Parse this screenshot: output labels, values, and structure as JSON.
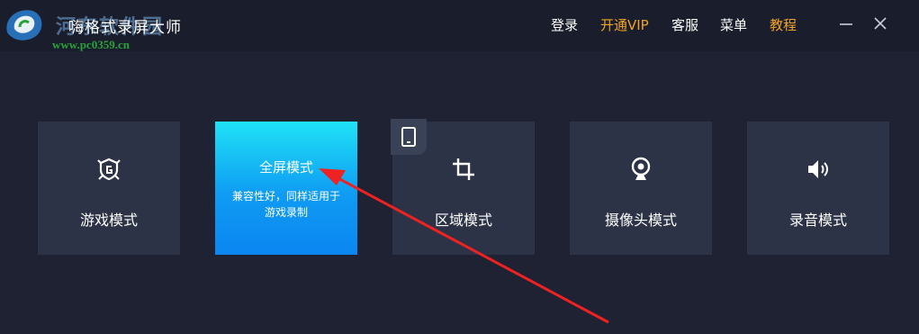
{
  "app": {
    "title": "嗨格式录屏大师",
    "watermark_text": "河东软件园",
    "watermark_url": "www.pc0359.cn"
  },
  "nav": {
    "login": "登录",
    "vip": "开通VIP",
    "service": "客服",
    "menu": "菜单",
    "tutorial": "教程"
  },
  "window_controls": [
    "minimize-icon",
    "close-icon"
  ],
  "modes": {
    "game": {
      "label": "游戏模式",
      "icon": "game-shield-icon"
    },
    "fullscreen": {
      "label": "全屏模式",
      "description": "兼容性好，同样适用于游戏录制",
      "selected": true
    },
    "region": {
      "label": "区域模式",
      "icon": "crop-icon",
      "badge_icon": "tablet-icon"
    },
    "camera": {
      "label": "摄像头模式",
      "icon": "webcam-icon"
    },
    "audio": {
      "label": "录音模式",
      "icon": "speaker-icon"
    }
  },
  "colors": {
    "background": "#1e2232",
    "titlebar": "#1a1e2c",
    "card": "#2c3346",
    "accent_gradient_top": "#1fe2f6",
    "accent_gradient_bottom": "#0b86f1",
    "vip_orange": "#f0a326",
    "annotation_arrow": "#ee2222"
  }
}
